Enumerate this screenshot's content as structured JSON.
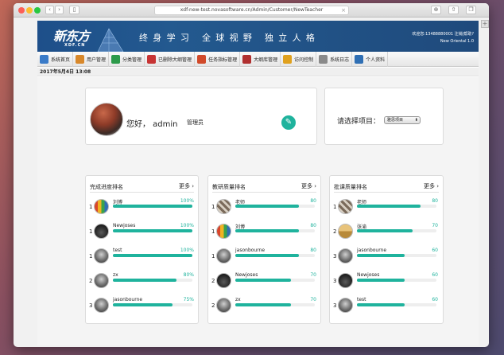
{
  "browser": {
    "url": "xdf-new-test.novasoftware.cn/Admin/Customer/NewTeacher"
  },
  "header": {
    "logo_main": "新东方",
    "logo_sub": "XDF.CN",
    "slogan": "终身学习 全球视野 独立人格",
    "login_line1": "欢迎您:13488880001 注销|帮助?",
    "login_line2": "New Oriental 1.0"
  },
  "menu": [
    {
      "label": "系统首页",
      "icon": "home-icon",
      "color": "#3a7bc8"
    },
    {
      "label": "用户管理",
      "icon": "user-manage-icon",
      "color": "#d8882b"
    },
    {
      "label": "分类管理",
      "icon": "category-icon",
      "color": "#2c9a4a"
    },
    {
      "label": "已删除大纲管理",
      "icon": "deleted-outline-icon",
      "color": "#c73434"
    },
    {
      "label": "任务指标管理",
      "icon": "flag-icon",
      "color": "#d14a2a"
    },
    {
      "label": "大纲库管理",
      "icon": "outline-library-icon",
      "color": "#b03030"
    },
    {
      "label": "访问控制",
      "icon": "lock-icon",
      "color": "#e0a11e"
    },
    {
      "label": "系统日志",
      "icon": "log-icon",
      "color": "#8a8a8a"
    },
    {
      "label": "个人资料",
      "icon": "profile-icon",
      "color": "#2f6fb4"
    }
  ],
  "date": "2017年5月4日 13:08",
  "profile": {
    "greeting": "您好， admin",
    "role": "管理员",
    "edit_icon": "edit-icon"
  },
  "project": {
    "label": "请选择项目：",
    "selected": "雅思项目"
  },
  "colors": {
    "accent": "#1fb39d",
    "banner": "#1f4f8a"
  },
  "rankings": [
    {
      "title": "完成进度排名",
      "more": "更多",
      "rows": [
        {
          "rank": "1",
          "name": "刘博",
          "value": "100%",
          "fraction": 1.0,
          "avatar": "colorful"
        },
        {
          "rank": "1",
          "name": "Newjoses",
          "value": "100%",
          "fraction": 1.0,
          "avatar": "dark"
        },
        {
          "rank": "1",
          "name": "test",
          "value": "100%",
          "fraction": 1.0,
          "avatar": "grey"
        },
        {
          "rank": "2",
          "name": "zx",
          "value": "80%",
          "fraction": 0.8,
          "avatar": "grey"
        },
        {
          "rank": "3",
          "name": "jasonbourne",
          "value": "75%",
          "fraction": 0.75,
          "avatar": "grey"
        }
      ]
    },
    {
      "title": "教研质量排名",
      "more": "更多",
      "rows": [
        {
          "rank": "1",
          "name": "老师",
          "value": "80",
          "fraction": 0.8,
          "avatar": "pattern"
        },
        {
          "rank": "1",
          "name": "刘博",
          "value": "80",
          "fraction": 0.8,
          "avatar": "colorful"
        },
        {
          "rank": "1",
          "name": "jasonbourne",
          "value": "80",
          "fraction": 0.8,
          "avatar": "grey"
        },
        {
          "rank": "2",
          "name": "Newjoses",
          "value": "70",
          "fraction": 0.7,
          "avatar": "dark"
        },
        {
          "rank": "2",
          "name": "zx",
          "value": "70",
          "fraction": 0.7,
          "avatar": "grey"
        }
      ]
    },
    {
      "title": "批课质量排名",
      "more": "更多",
      "rows": [
        {
          "rank": "1",
          "name": "老师",
          "value": "80",
          "fraction": 0.8,
          "avatar": "pattern"
        },
        {
          "rank": "2",
          "name": "张渝",
          "value": "70",
          "fraction": 0.7,
          "avatar": "sand"
        },
        {
          "rank": "3",
          "name": "jasonbourne",
          "value": "60",
          "fraction": 0.6,
          "avatar": "grey"
        },
        {
          "rank": "3",
          "name": "Newjoses",
          "value": "60",
          "fraction": 0.6,
          "avatar": "dark"
        },
        {
          "rank": "3",
          "name": "test",
          "value": "60",
          "fraction": 0.6,
          "avatar": "grey"
        }
      ]
    }
  ]
}
